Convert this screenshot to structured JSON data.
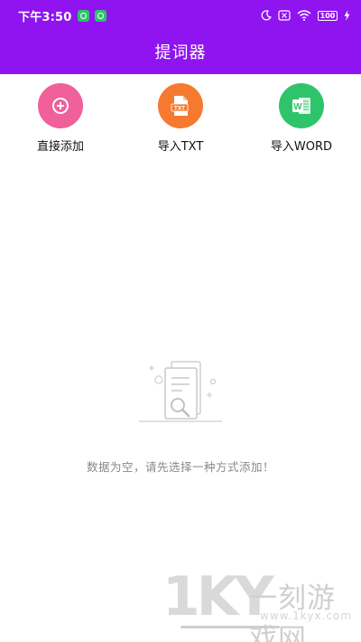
{
  "status_bar": {
    "time": "下午3:50",
    "notification_icons": [
      "wechat-icon",
      "wechat-icon"
    ],
    "battery_level": "100",
    "right_icons": [
      "moon-icon",
      "sim-off-icon",
      "wifi-icon",
      "battery-icon",
      "charging-icon"
    ]
  },
  "header": {
    "title": "提词器",
    "background_color": "#8f14f0"
  },
  "actions": [
    {
      "label": "直接添加",
      "icon": "plus-icon",
      "color": "#f0609a"
    },
    {
      "label": "导入TXT",
      "icon": "txt-file-icon",
      "icon_text": "TXT",
      "color": "#f57a30"
    },
    {
      "label": "导入WORD",
      "icon": "word-file-icon",
      "icon_text": "W",
      "color": "#2fc46a"
    }
  ],
  "empty_state": {
    "icon": "empty-documents-icon",
    "message": "数据为空，请先选择一种方式添加！"
  },
  "watermark": {
    "logo": "1KY",
    "name": "一刻游戏网",
    "url": "www.1kyx.com"
  }
}
